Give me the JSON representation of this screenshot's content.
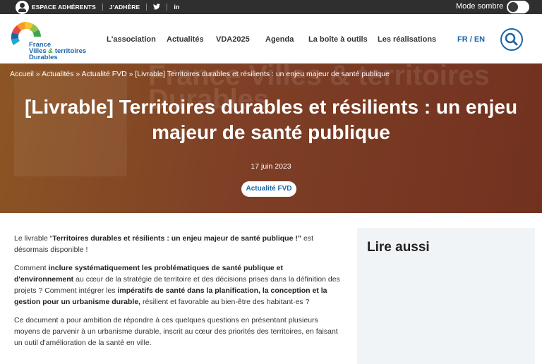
{
  "topbar": {
    "member_space": "ESPACE ADHÉRENTS",
    "join": "J'ADHÈRE",
    "social_twitter": "🐦",
    "social_linkedin": "in",
    "dark_mode_label": "Mode sombre"
  },
  "logo": {
    "line1": "France",
    "line2a": "Villes",
    "amp": "&",
    "line2b": "territoires",
    "line3": "Durables"
  },
  "nav": {
    "items": [
      "L'association",
      "Actualités",
      "VDA2025",
      "Agenda",
      "La boîte à outils",
      "Les réalisations"
    ],
    "lang": "FR / EN"
  },
  "hero": {
    "breadcrumb": "Accueil » Actualités » Actualité FVD » [Livrable] Territoires durables et résilients : un enjeu majeur de santé publique",
    "title": "[Livrable] Territoires durables et résilients : un enjeu majeur de santé publique",
    "date": "17 juin 2023",
    "badge": "Actualité FVD",
    "bg_text": "France Villes & territoires Durables"
  },
  "article": {
    "p1_a": "Le livrable “",
    "p1_b": "Territoires durables et résilients : un enjeu majeur de santé publique !”",
    "p1_c": " est désormais disponible !",
    "p2_a": "Comment ",
    "p2_b": "inclure systématiquement les problématiques de santé publique et d'environnement",
    "p2_c": " au cœur de la stratégie de territoire et des décisions prises dans la définition des projets ? Comment intégrer les ",
    "p2_d": "impératifs de santé dans la planification, la conception et la gestion pour un urbanisme durable,",
    "p2_e": " résilient et favorable au bien-être des habitant·es ?",
    "p3": "Ce document a pour ambition de répondre à ces quelques questions en présentant plusieurs moyens de parvenir à un urbanisme durable, inscrit au cœur des priorités des territoires, en faisant un outil d'amélioration de la santé en ville."
  },
  "aside": {
    "title": "Lire aussi"
  },
  "colors": {
    "accent": "#1b66a8",
    "hero_bg": "#7e3f26",
    "topbar": "#2f2f2f",
    "aside_bg": "#f1f4f7"
  }
}
